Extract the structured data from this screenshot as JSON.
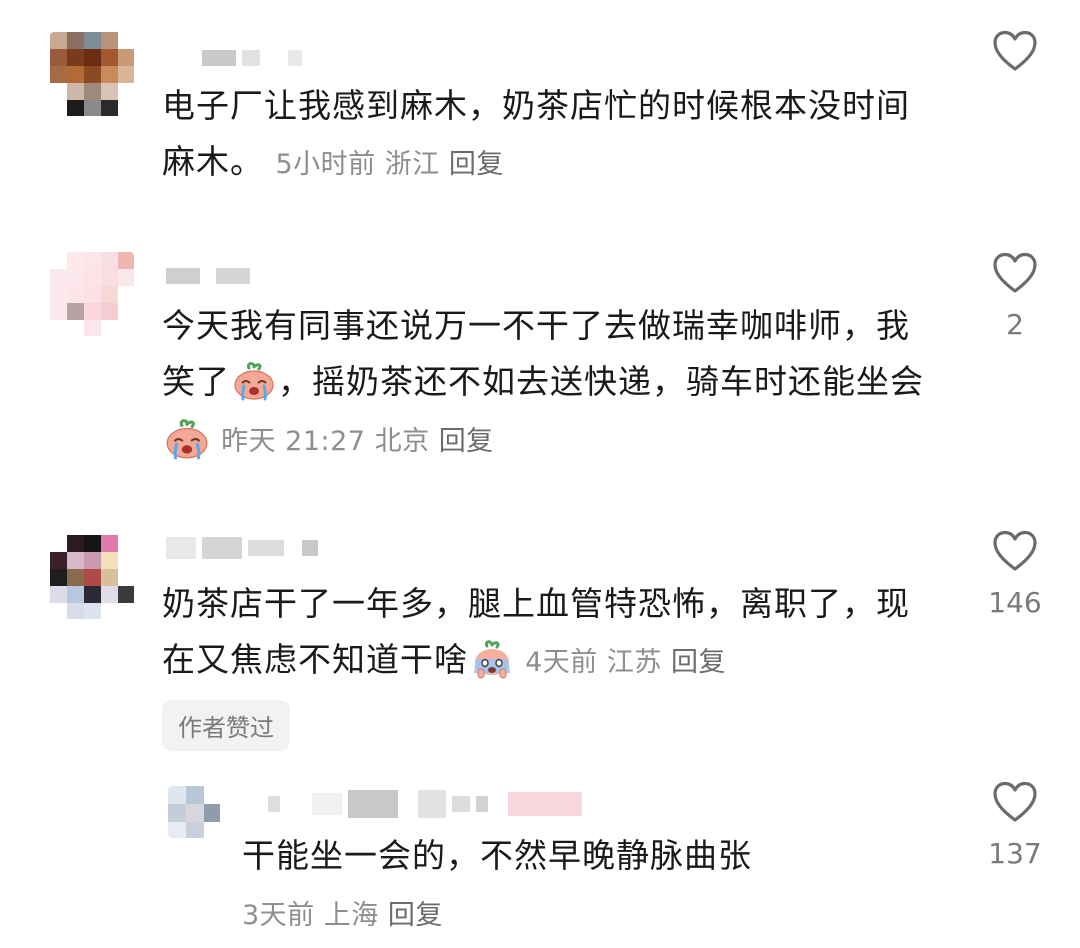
{
  "comments": [
    {
      "text": "电子厂让我感到麻木，奶茶店忙的时候根本没时间麻木。",
      "line1": "电子厂让我感到麻木，奶茶店忙的时候根本没时间",
      "line2": "麻木。",
      "time": "5小时前",
      "location": "浙江",
      "reply": "回复",
      "likes": ""
    },
    {
      "line1": "今天我有同事还说万一不干了去做瑞幸咖啡师，我",
      "line2a": "笑了",
      "line2b": "，摇奶茶还不如去送快递，骑车时还能坐会",
      "time": "昨天 21:27",
      "location": "北京",
      "reply": "回复",
      "likes": "2"
    },
    {
      "line1": "奶茶店干了一年多，腿上血管特恐怖，离职了，现",
      "line2": "在又焦虑不知道干啥",
      "time": "4天前",
      "location": "江苏",
      "reply": "回复",
      "likes": "146",
      "badge": "作者赞过"
    },
    {
      "text": "干能坐一会的，不然早晚静脉曲张",
      "time": "3天前",
      "location": "上海",
      "reply": "回复",
      "likes": "137"
    }
  ],
  "icons": {
    "like": "heart-outline-icon",
    "emoji_crying": "crying-face-emoji",
    "emoji_scared": "scared-face-emoji"
  },
  "colors": {
    "text": "#1a1a1a",
    "meta": "#8e8e8e",
    "like_icon": "#6b6b6b",
    "badge_bg": "#f2f2f2"
  }
}
